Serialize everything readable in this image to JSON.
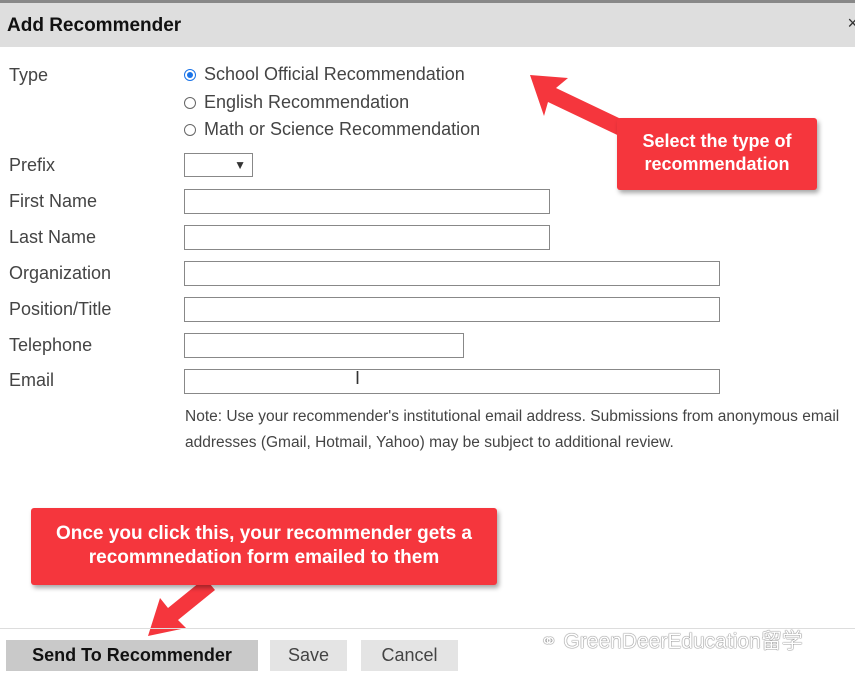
{
  "dialog": {
    "title": "Add Recommender",
    "close_icon": "close-icon"
  },
  "form": {
    "type_label": "Type",
    "type_options": [
      {
        "label": "School Official Recommendation",
        "selected": true
      },
      {
        "label": "English Recommendation",
        "selected": false
      },
      {
        "label": "Math or Science Recommendation",
        "selected": false
      }
    ],
    "prefix_label": "Prefix",
    "prefix_value": "",
    "first_name_label": "First Name",
    "last_name_label": "Last Name",
    "organization_label": "Organization",
    "position_label": "Position/Title",
    "telephone_label": "Telephone",
    "email_label": "Email",
    "note": "Note: Use your recommender's institutional email address. Submissions from anonymous email addresses (Gmail, Hotmail, Yahoo) may be subject to additional review."
  },
  "annotations": {
    "type_callout": "Select the type of recommendation",
    "send_callout": "Once you click this, your recommender gets a recommnedation form emailed to them",
    "color": "#f5363d"
  },
  "footer": {
    "send_label": "Send To Recommender",
    "save_label": "Save",
    "cancel_label": "Cancel"
  },
  "watermark": "GreenDeerEducation留学"
}
